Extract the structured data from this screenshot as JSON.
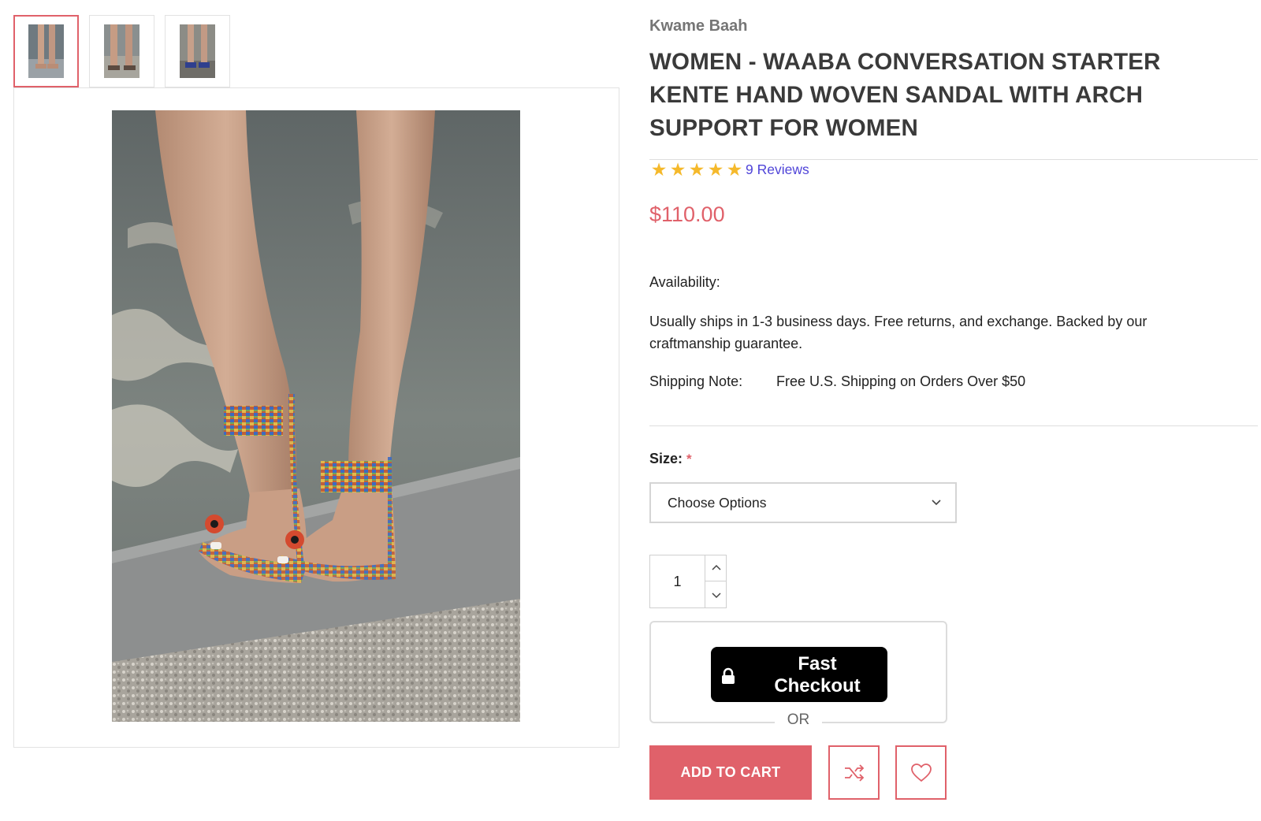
{
  "gallery": {
    "thumbnails": [
      {
        "alt": "thumbnail-1",
        "active": true
      },
      {
        "alt": "thumbnail-2",
        "active": false
      },
      {
        "alt": "thumbnail-3",
        "active": false
      }
    ]
  },
  "product": {
    "brand": "Kwame Baah",
    "title": "WOMEN - WAABA CONVERSATION STARTER KENTE HAND WOVEN SANDAL WITH ARCH SUPPORT FOR WOMEN",
    "rating_stars": 5,
    "reviews_label": "9 Reviews",
    "price": "$110.00",
    "availability_label": "Availability:",
    "description": "Usually ships in 1-3 business days. Free returns, and exchange. Backed by our craftmanship guarantee.",
    "shipping_label": "Shipping Note:",
    "shipping_value": "Free U.S. Shipping on Orders Over $50"
  },
  "options": {
    "size_label": "Size:",
    "required_mark": "*",
    "size_selected": "Choose Options"
  },
  "quantity": {
    "value": "1"
  },
  "checkout": {
    "fast_checkout_label_line1": "Fast",
    "fast_checkout_label_line2": "Checkout",
    "or_label": "OR",
    "add_to_cart_label": "ADD TO CART"
  },
  "colors": {
    "accent": "#e0616a",
    "star": "#f5b92b",
    "link": "#4f44d8"
  },
  "icons": [
    "lock-icon",
    "shuffle-compare-icon",
    "heart-wishlist-icon",
    "chevron-down-icon",
    "chevron-up-icon",
    "star-icon"
  ]
}
